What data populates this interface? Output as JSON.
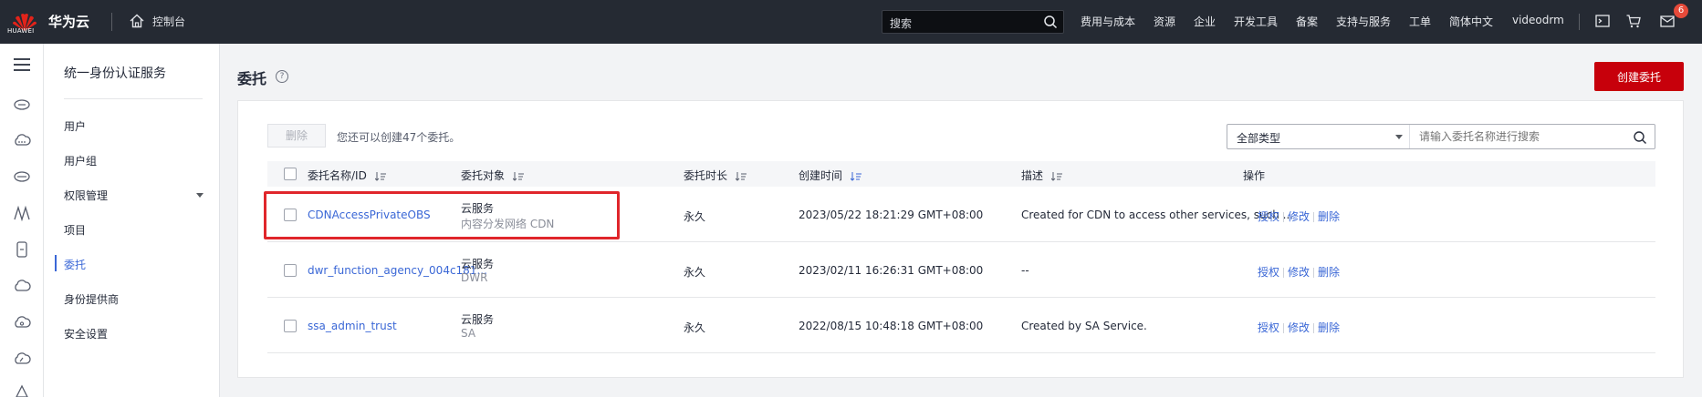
{
  "topbar": {
    "logo_text": "HUAWEI",
    "brand": "华为云",
    "console": "控制台",
    "search_placeholder": "搜索",
    "nav": [
      "费用与成本",
      "资源",
      "企业",
      "开发工具",
      "备案",
      "支持与服务",
      "工单",
      "简体中文",
      "videodrm"
    ],
    "badge_count": "6",
    "colors": {
      "bar": "#252a33",
      "badge": "#e64a3a"
    }
  },
  "rail": {
    "icons": [
      "cloud-server-icon",
      "cloud-compute-icon",
      "database-icon",
      "network-icon",
      "mobile-icon",
      "cloud-icon",
      "cloud-storage-icon",
      "cloud-cdn-icon",
      "more-icon"
    ]
  },
  "sidebar": {
    "title": "统一身份认证服务",
    "items": [
      {
        "label": "用户"
      },
      {
        "label": "用户组"
      },
      {
        "label": "权限管理"
      },
      {
        "label": "项目"
      },
      {
        "label": "委托"
      },
      {
        "label": "身份提供商"
      },
      {
        "label": "安全设置"
      }
    ],
    "active_index": 4
  },
  "main": {
    "title": "委托",
    "create_button": "创建委托",
    "delete_button": "删除",
    "can_create_text": "您还可以创建47个委托。",
    "filter": {
      "type_selected": "全部类型",
      "search_placeholder": "请输入委托名称进行搜索"
    },
    "columns": [
      "委托名称/ID",
      "委托对象",
      "委托时长",
      "创建时间",
      "描述",
      "操作"
    ],
    "rows": [
      {
        "name": "CDNAccessPrivateOBS",
        "target": "云服务",
        "target_sub": "内容分发网络 CDN",
        "duration": "永久",
        "created": "2023/05/22 18:21:29 GMT+08:00",
        "description": "Created for CDN to access other services, such ...",
        "ops": [
          "授权",
          "修改",
          "删除"
        ]
      },
      {
        "name": "dwr_function_agency_004c181...",
        "target": "云服务",
        "target_sub": "DWR",
        "duration": "永久",
        "created": "2023/02/11 16:26:31 GMT+08:00",
        "description": "--",
        "ops": [
          "授权",
          "修改",
          "删除"
        ]
      },
      {
        "name": "ssa_admin_trust",
        "target": "云服务",
        "target_sub": "SA",
        "duration": "永久",
        "created": "2022/08/15 10:48:18 GMT+08:00",
        "description": "Created by SA Service.",
        "ops": [
          "授权",
          "修改",
          "删除"
        ]
      }
    ],
    "colors": {
      "primary_button": "#c7000b",
      "link": "#3a67d6",
      "highlight_box": "#e0262b"
    }
  }
}
